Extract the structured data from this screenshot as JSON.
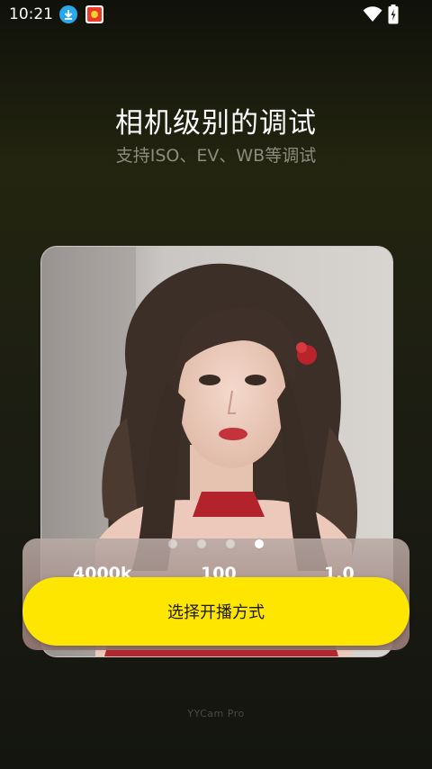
{
  "status_bar": {
    "time": "10:21",
    "icons": [
      "download-icon",
      "app-notification-icon",
      "wifi-icon",
      "battery-charging-icon"
    ]
  },
  "onboarding": {
    "title": "相机级别的调试",
    "subtitle": "支持ISO、EV、WB等调试",
    "metrics": [
      "4000k",
      "100",
      "1.0"
    ],
    "page_indicator": {
      "total": 4,
      "active": 4
    },
    "cta_label": "选择开播方式",
    "brand": "YYCam Pro"
  },
  "colors": {
    "accent": "#ffe600",
    "background": "#1e2012"
  }
}
